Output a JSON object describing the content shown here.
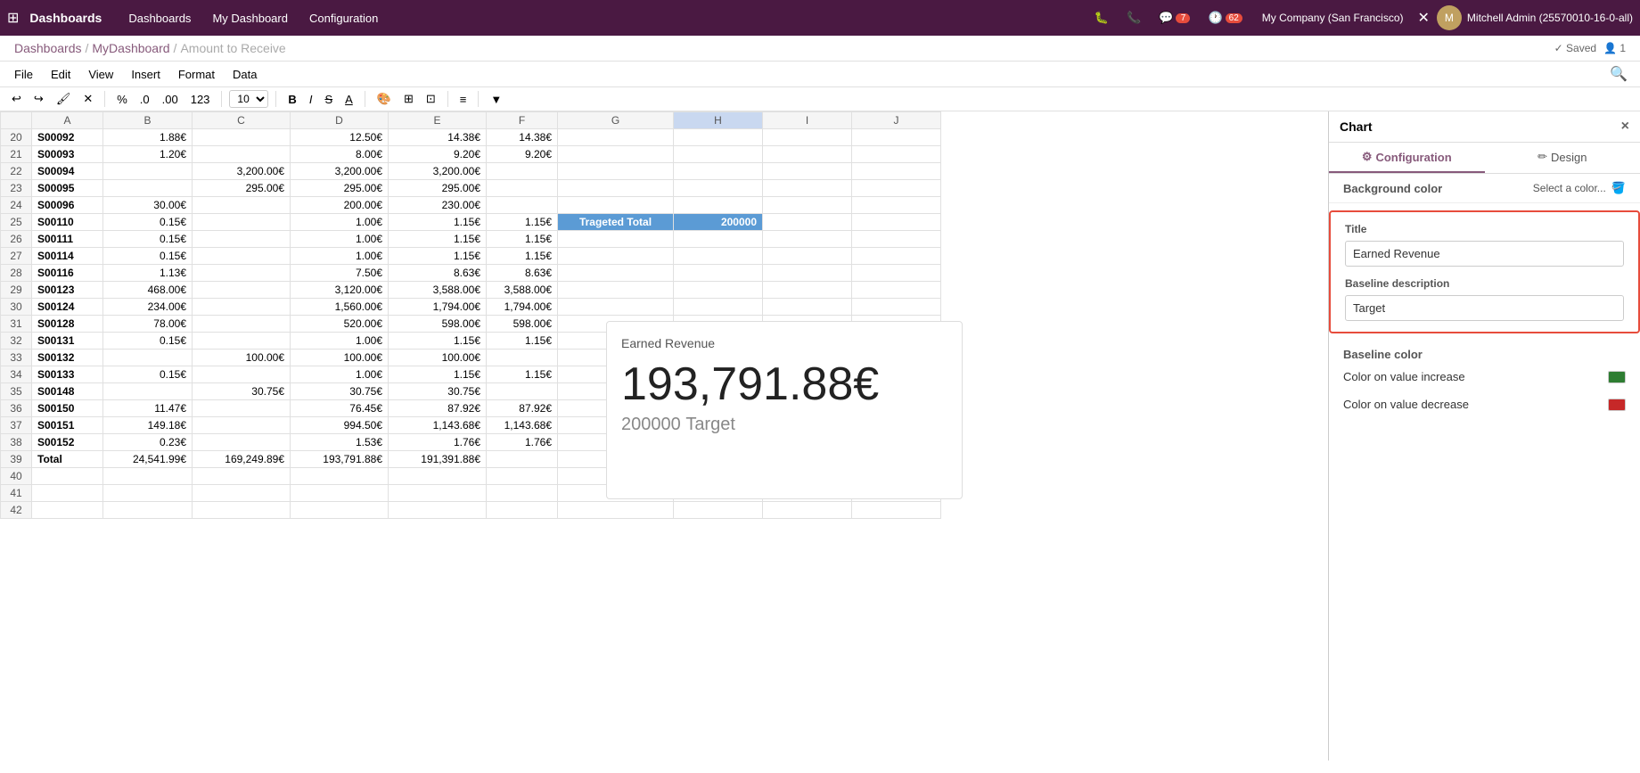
{
  "topNav": {
    "appName": "Dashboards",
    "navItems": [
      "Dashboards",
      "My Dashboard",
      "Configuration"
    ],
    "icons": {
      "debug": "🐛",
      "phone": "📞",
      "chat": "💬",
      "chatBadge": "7",
      "activity": "🕐",
      "activityBadge": "62"
    },
    "company": "My Company (San Francisco)",
    "user": "Mitchell Admin (25570010-16-0-all)"
  },
  "breadcrumb": {
    "parts": [
      "Dashboards",
      "MyDashboard",
      "Amount to Receive"
    ],
    "saved": "✓ Saved",
    "users": "👤 1"
  },
  "menuBar": {
    "items": [
      "File",
      "Edit",
      "View",
      "Insert",
      "Format",
      "Data"
    ]
  },
  "toolbar": {
    "percent": "%",
    "dot0": ".0",
    "dot00": ".00",
    "num123": "123",
    "fontSize": "10",
    "bold": "B",
    "italic": "I",
    "strike": "S",
    "underline": "U",
    "fillColor": "A",
    "borders": "▦",
    "merge": "⊞",
    "align": "≡",
    "filter": "▼"
  },
  "columns": [
    "",
    "A",
    "B",
    "C",
    "D",
    "E",
    "F",
    "G",
    "H",
    "I",
    "J"
  ],
  "rows": [
    {
      "num": "20",
      "a": "S00092",
      "b": "1.88€",
      "c": "",
      "d": "12.50€",
      "e": "14.38€",
      "f": "14.38€",
      "g": "",
      "h": "",
      "i": "",
      "j": ""
    },
    {
      "num": "21",
      "a": "S00093",
      "b": "1.20€",
      "c": "",
      "d": "8.00€",
      "e": "9.20€",
      "f": "9.20€",
      "g": "",
      "h": "",
      "i": "",
      "j": ""
    },
    {
      "num": "22",
      "a": "S00094",
      "b": "",
      "c": "3,200.00€",
      "d": "3,200.00€",
      "e": "3,200.00€",
      "f": "",
      "g": "",
      "h": "",
      "i": "",
      "j": ""
    },
    {
      "num": "23",
      "a": "S00095",
      "b": "",
      "c": "295.00€",
      "d": "295.00€",
      "e": "295.00€",
      "f": "",
      "g": "",
      "h": "",
      "i": "",
      "j": ""
    },
    {
      "num": "24",
      "a": "S00096",
      "b": "30.00€",
      "c": "",
      "d": "200.00€",
      "e": "230.00€",
      "f": "",
      "g": "",
      "h": "",
      "i": "",
      "j": ""
    },
    {
      "num": "25",
      "a": "S00110",
      "b": "0.15€",
      "c": "",
      "d": "1.00€",
      "e": "1.15€",
      "f": "1.15€",
      "g": "Trageted Total",
      "h": "200000",
      "i": "",
      "j": ""
    },
    {
      "num": "26",
      "a": "S00111",
      "b": "0.15€",
      "c": "",
      "d": "1.00€",
      "e": "1.15€",
      "f": "1.15€",
      "g": "",
      "h": "",
      "i": "",
      "j": ""
    },
    {
      "num": "27",
      "a": "S00114",
      "b": "0.15€",
      "c": "",
      "d": "1.00€",
      "e": "1.15€",
      "f": "1.15€",
      "g": "",
      "h": "",
      "i": "",
      "j": ""
    },
    {
      "num": "28",
      "a": "S00116",
      "b": "1.13€",
      "c": "",
      "d": "7.50€",
      "e": "8.63€",
      "f": "8.63€",
      "g": "",
      "h": "",
      "i": "",
      "j": ""
    },
    {
      "num": "29",
      "a": "S00123",
      "b": "468.00€",
      "c": "",
      "d": "3,120.00€",
      "e": "3,588.00€",
      "f": "3,588.00€",
      "g": "",
      "h": "",
      "i": "",
      "j": ""
    },
    {
      "num": "30",
      "a": "S00124",
      "b": "234.00€",
      "c": "",
      "d": "1,560.00€",
      "e": "1,794.00€",
      "f": "1,794.00€",
      "g": "",
      "h": "",
      "i": "",
      "j": ""
    },
    {
      "num": "31",
      "a": "S00128",
      "b": "78.00€",
      "c": "",
      "d": "520.00€",
      "e": "598.00€",
      "f": "598.00€",
      "g": "",
      "h": "",
      "i": "",
      "j": ""
    },
    {
      "num": "32",
      "a": "S00131",
      "b": "0.15€",
      "c": "",
      "d": "1.00€",
      "e": "1.15€",
      "f": "1.15€",
      "g": "",
      "h": "",
      "i": "",
      "j": ""
    },
    {
      "num": "33",
      "a": "S00132",
      "b": "",
      "c": "100.00€",
      "d": "100.00€",
      "e": "100.00€",
      "f": "",
      "g": "",
      "h": "",
      "i": "",
      "j": ""
    },
    {
      "num": "34",
      "a": "S00133",
      "b": "0.15€",
      "c": "",
      "d": "1.00€",
      "e": "1.15€",
      "f": "1.15€",
      "g": "",
      "h": "",
      "i": "",
      "j": ""
    },
    {
      "num": "35",
      "a": "S00148",
      "b": "",
      "c": "30.75€",
      "d": "30.75€",
      "e": "30.75€",
      "f": "",
      "g": "",
      "h": "",
      "i": "",
      "j": ""
    },
    {
      "num": "36",
      "a": "S00150",
      "b": "11.47€",
      "c": "",
      "d": "76.45€",
      "e": "87.92€",
      "f": "87.92€",
      "g": "",
      "h": "",
      "i": "",
      "j": ""
    },
    {
      "num": "37",
      "a": "S00151",
      "b": "149.18€",
      "c": "",
      "d": "994.50€",
      "e": "1,143.68€",
      "f": "1,143.68€",
      "g": "",
      "h": "",
      "i": "",
      "j": ""
    },
    {
      "num": "38",
      "a": "S00152",
      "b": "0.23€",
      "c": "",
      "d": "1.53€",
      "e": "1.76€",
      "f": "1.76€",
      "g": "",
      "h": "",
      "i": "",
      "j": ""
    },
    {
      "num": "39",
      "a": "Total",
      "b": "24,541.99€",
      "c": "169,249.89€",
      "d": "193,791.88€",
      "e": "191,391.88€",
      "f": "",
      "g": "",
      "h": "",
      "i": "",
      "j": ""
    },
    {
      "num": "40",
      "a": "",
      "b": "",
      "c": "",
      "d": "",
      "e": "",
      "f": "",
      "g": "",
      "h": "",
      "i": "",
      "j": ""
    },
    {
      "num": "41",
      "a": "",
      "b": "",
      "c": "",
      "d": "",
      "e": "",
      "f": "",
      "g": "",
      "h": "",
      "i": "",
      "j": ""
    },
    {
      "num": "42",
      "a": "",
      "b": "",
      "c": "",
      "d": "",
      "e": "",
      "f": "",
      "g": "",
      "h": "",
      "i": "",
      "j": ""
    }
  ],
  "chartWidget": {
    "title": "Earned Revenue",
    "value": "193,791.88€",
    "targetValue": "200000",
    "targetLabel": "Target"
  },
  "rightPanel": {
    "title": "Chart",
    "closeLabel": "×",
    "tabs": [
      {
        "label": "Configuration",
        "icon": "⚙"
      },
      {
        "label": "Design",
        "icon": "✏"
      }
    ],
    "bgColorLabel": "Background color",
    "bgColorAction": "Select a color...",
    "titleSectionLabel": "Title",
    "titleInputValue": "Earned Revenue",
    "titleInputPlaceholder": "Earned Revenue",
    "baselineLabel": "Baseline description",
    "baselineInputValue": "Target",
    "baselineInputPlaceholder": "Target",
    "baselineColorLabel": "Baseline color",
    "colorIncreaseLabel": "Color on value increase",
    "colorDecreaseLabel": "Color on value decrease"
  }
}
